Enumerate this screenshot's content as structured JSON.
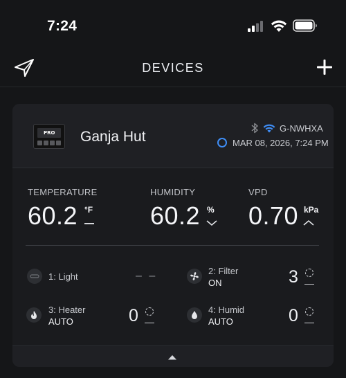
{
  "status_bar": {
    "time": "7:24"
  },
  "header": {
    "title": "DEVICES"
  },
  "device": {
    "thumb_label": "PRO",
    "name": "Ganja Hut",
    "device_id": "G-NWHXA",
    "timestamp": "MAR 08, 2026, 7:24 PM",
    "status_color": "#3f8ef7"
  },
  "metrics": {
    "temperature": {
      "label": "TEMPERATURE",
      "value": "60.2",
      "unit": "°F",
      "trend": "flat"
    },
    "humidity": {
      "label": "HUMIDITY",
      "value": "60.2",
      "unit": "%",
      "trend": "down"
    },
    "vpd": {
      "label": "VPD",
      "value": "0.70",
      "unit": "kPa",
      "trend": "up"
    }
  },
  "ports": [
    {
      "name": "1: Light",
      "mode": "",
      "value": "– –",
      "icon": "light-icon"
    },
    {
      "name": "2: Filter",
      "mode": "ON",
      "value": "3",
      "icon": "fan-icon"
    },
    {
      "name": "3: Heater",
      "mode": "AUTO",
      "value": "0",
      "icon": "flame-icon"
    },
    {
      "name": "4: Humid",
      "mode": "AUTO",
      "value": "0",
      "icon": "droplet-icon"
    }
  ]
}
